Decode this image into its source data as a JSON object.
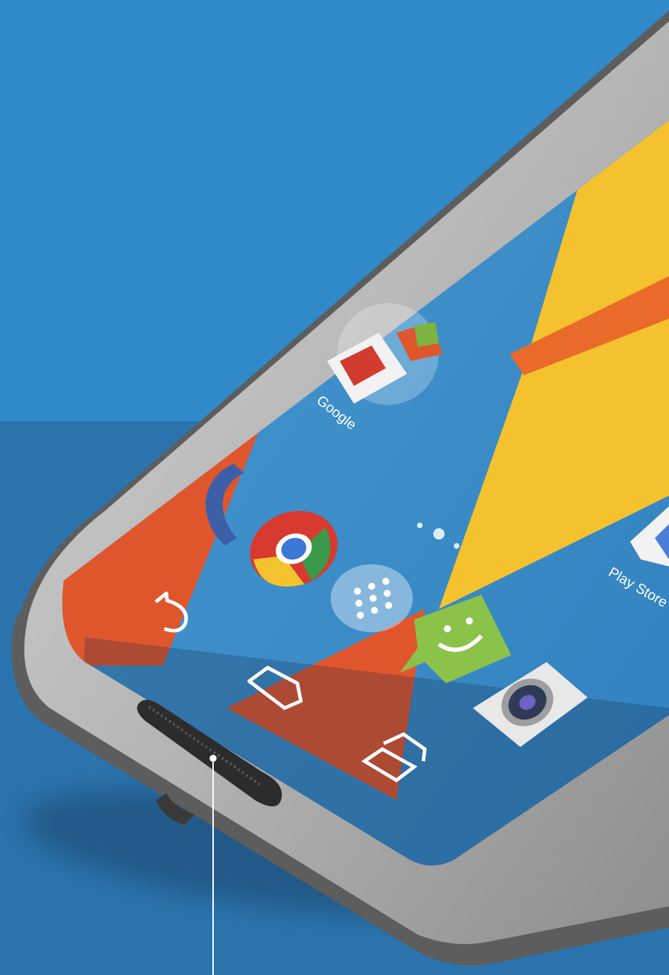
{
  "home_screen": {
    "apps": [
      {
        "name": "google-folder",
        "label": "Google",
        "icon": "gmail-folder-icon"
      },
      {
        "name": "phone",
        "label": "",
        "icon": "phone-icon"
      },
      {
        "name": "chrome",
        "label": "",
        "icon": "chrome-icon"
      },
      {
        "name": "app-drawer",
        "label": "",
        "icon": "app-drawer-icon"
      },
      {
        "name": "messaging",
        "label": "",
        "icon": "messaging-icon"
      },
      {
        "name": "camera",
        "label": "",
        "icon": "camera-icon"
      },
      {
        "name": "play-store",
        "label": "Play Store",
        "icon": "play-store-icon"
      }
    ],
    "page_indicator_dots": 3
  },
  "nav_bar": {
    "buttons": [
      "back-icon",
      "home-icon",
      "recents-icon"
    ]
  },
  "colors": {
    "background": "#3089c8",
    "wallpaper_orange": "#e0562c",
    "wallpaper_yellow": "#f5c22f",
    "bezel": "#b8b8b8"
  }
}
